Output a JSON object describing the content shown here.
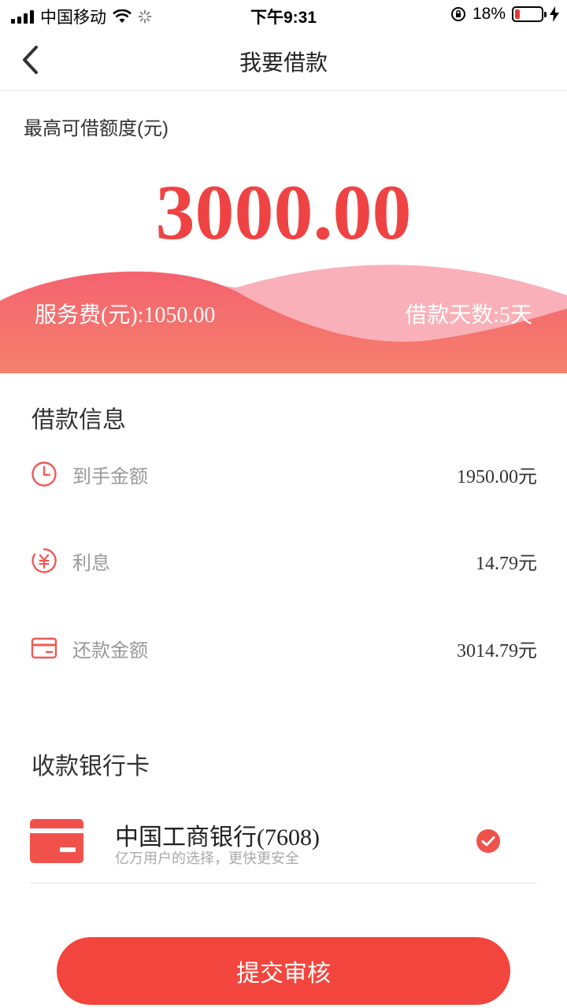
{
  "status_bar": {
    "carrier": "中国移动",
    "time": "下午9:31",
    "battery": "18%",
    "battery_level": 0.18
  },
  "nav": {
    "title": "我要借款"
  },
  "hero": {
    "limit_label": "最高可借额度(元)",
    "limit_amount": "3000.00",
    "service_fee": "服务费(元):1050.00",
    "loan_days": "借款天数:5天"
  },
  "loan_info": {
    "title": "借款信息",
    "rows": [
      {
        "icon": "clock-icon",
        "label": "到手金额",
        "value": "1950.00元"
      },
      {
        "icon": "yuan-coin-icon",
        "label": "利息",
        "value": "14.79元"
      },
      {
        "icon": "card-icon",
        "label": "还款金额",
        "value": "3014.79元"
      }
    ]
  },
  "bank": {
    "title": "收款银行卡",
    "name": "中国工商银行(7608)",
    "subtitle": "亿万用户的选择，更快更安全",
    "selected": true
  },
  "submit": {
    "label": "提交审核"
  },
  "colors": {
    "accent": "#ef4343",
    "button": "#f2453d",
    "wave_back": "#f9b1b8",
    "wave_front": "#f46d74"
  }
}
